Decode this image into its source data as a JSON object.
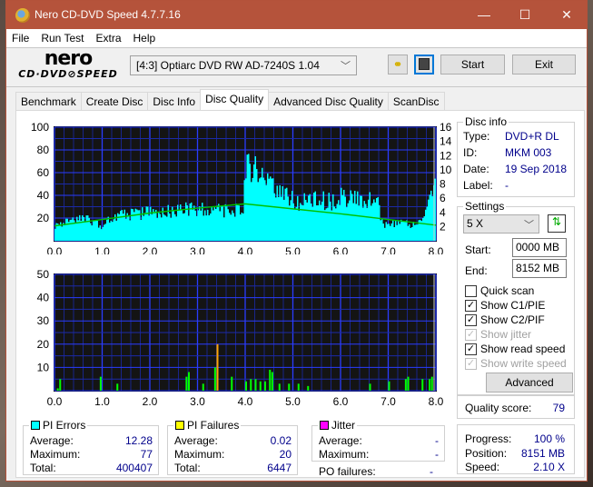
{
  "window": {
    "title": "Nero CD-DVD Speed 4.7.7.16",
    "controls": {
      "minimize": "—",
      "maximize": "☐",
      "close": "✕"
    }
  },
  "menu": [
    "File",
    "Run Test",
    "Extra",
    "Help"
  ],
  "toolbar": {
    "logo_top": "nero",
    "logo_bottom": "CD·DVD⊘SPEED",
    "drive": "[4:3]  Optiarc DVD RW AD-7240S 1.04",
    "start_label": "Start",
    "exit_label": "Exit"
  },
  "tabs": [
    {
      "label": "Benchmark",
      "active": false
    },
    {
      "label": "Create Disc",
      "active": false
    },
    {
      "label": "Disc Info",
      "active": false
    },
    {
      "label": "Disc Quality",
      "active": true
    },
    {
      "label": "Advanced Disc Quality",
      "active": false
    },
    {
      "label": "ScanDisc",
      "active": false
    }
  ],
  "disc_info": {
    "title": "Disc info",
    "type_label": "Type:",
    "type": "DVD+R DL",
    "id_label": "ID:",
    "id": "MKM 003",
    "date_label": "Date:",
    "date": "19 Sep 2018",
    "label_label": "Label:",
    "label": "-"
  },
  "settings": {
    "title": "Settings",
    "speed": "5 X",
    "start_label": "Start:",
    "start": "0000 MB",
    "end_label": "End:",
    "end": "8152 MB",
    "quick_scan": "Quick scan",
    "show_c1": "Show C1/PIE",
    "show_c2": "Show C2/PIF",
    "show_jitter": "Show jitter",
    "show_read": "Show read speed",
    "show_write": "Show write speed",
    "advanced_label": "Advanced"
  },
  "quality": {
    "label": "Quality score:",
    "value": "79"
  },
  "progress": {
    "progress_label": "Progress:",
    "progress": "100 %",
    "position_label": "Position:",
    "position": "8151 MB",
    "speed_label": "Speed:",
    "speed": "2.10 X"
  },
  "pi_errors": {
    "title": "PI Errors",
    "color": "#00ffff",
    "average_label": "Average:",
    "average": "12.28",
    "maximum_label": "Maximum:",
    "maximum": "77",
    "total_label": "Total:",
    "total": "400407"
  },
  "pi_failures": {
    "title": "PI Failures",
    "color": "#ffff00",
    "average_label": "Average:",
    "average": "0.02",
    "maximum_label": "Maximum:",
    "maximum": "20",
    "total_label": "Total:",
    "total": "6447"
  },
  "jitter": {
    "title": "Jitter",
    "color": "#ff00ff",
    "average_label": "Average:",
    "average": "-",
    "maximum_label": "Maximum:",
    "maximum": "-",
    "po_label": "PO failures:",
    "po": "-"
  },
  "chart_data": [
    {
      "type": "bar",
      "title": "PI Errors",
      "x_ticks": [
        "0.0",
        "1.0",
        "2.0",
        "3.0",
        "4.0",
        "5.0",
        "6.0",
        "7.0",
        "8.0"
      ],
      "xlim": [
        0,
        8
      ],
      "y_ticks": [
        "20",
        "40",
        "60",
        "80",
        "100"
      ],
      "ylim": [
        0,
        100
      ],
      "y2_ticks": [
        "2",
        "4",
        "6",
        "8",
        "10",
        "12",
        "14",
        "16"
      ],
      "y2lim": [
        0,
        16
      ],
      "series": [
        {
          "name": "PI Errors",
          "color": "#00ffff",
          "x": [
            0.0,
            0.25,
            0.5,
            0.75,
            1.0,
            1.2,
            1.5,
            1.75,
            2.0,
            2.25,
            2.5,
            2.75,
            3.0,
            3.25,
            3.5,
            3.75,
            3.95,
            4.0,
            4.1,
            4.25,
            4.5,
            4.75,
            5.0,
            5.25,
            5.5,
            5.75,
            6.0,
            6.25,
            6.5,
            6.75,
            6.9,
            7.0,
            7.25,
            7.5,
            7.75,
            7.9,
            8.0
          ],
          "values": [
            14,
            17,
            18,
            18,
            12,
            22,
            23,
            24,
            25,
            26,
            27,
            28,
            28,
            27,
            26,
            25,
            30,
            62,
            70,
            55,
            55,
            40,
            35,
            35,
            36,
            35,
            38,
            37,
            36,
            35,
            14,
            15,
            15,
            14,
            20,
            42,
            45
          ]
        },
        {
          "name": "Read speed",
          "color": "#00c000",
          "axis": "right",
          "x": [
            0.0,
            1.0,
            2.0,
            3.0,
            4.0,
            5.0,
            6.0,
            7.0,
            8.0
          ],
          "values": [
            2.1,
            3.0,
            3.9,
            4.6,
            5.2,
            4.5,
            3.8,
            3.0,
            2.2
          ]
        }
      ]
    },
    {
      "type": "bar",
      "title": "PI Failures",
      "x_ticks": [
        "0.0",
        "1.0",
        "2.0",
        "3.0",
        "4.0",
        "5.0",
        "6.0",
        "7.0",
        "8.0"
      ],
      "xlim": [
        0,
        8
      ],
      "y_ticks": [
        "10",
        "20",
        "30",
        "40",
        "50"
      ],
      "ylim": [
        0,
        50
      ],
      "series": [
        {
          "name": "PI Failures",
          "color": "#00ff00",
          "x": [
            0.05,
            0.1,
            0.95,
            1.3,
            2.75,
            2.8,
            3.1,
            3.35,
            3.4,
            3.7,
            4.0,
            4.1,
            4.2,
            4.3,
            4.4,
            4.5,
            4.55,
            4.7,
            4.9,
            5.1,
            5.3,
            6.6,
            7.0,
            7.35,
            7.4,
            7.7,
            7.85,
            7.9
          ],
          "values": [
            1,
            5,
            6,
            3,
            6,
            8,
            3,
            10,
            20,
            6,
            4,
            5,
            5,
            4,
            4,
            9,
            8,
            3,
            3,
            3,
            2,
            3,
            4,
            5,
            6,
            5,
            5,
            6
          ]
        }
      ]
    }
  ]
}
